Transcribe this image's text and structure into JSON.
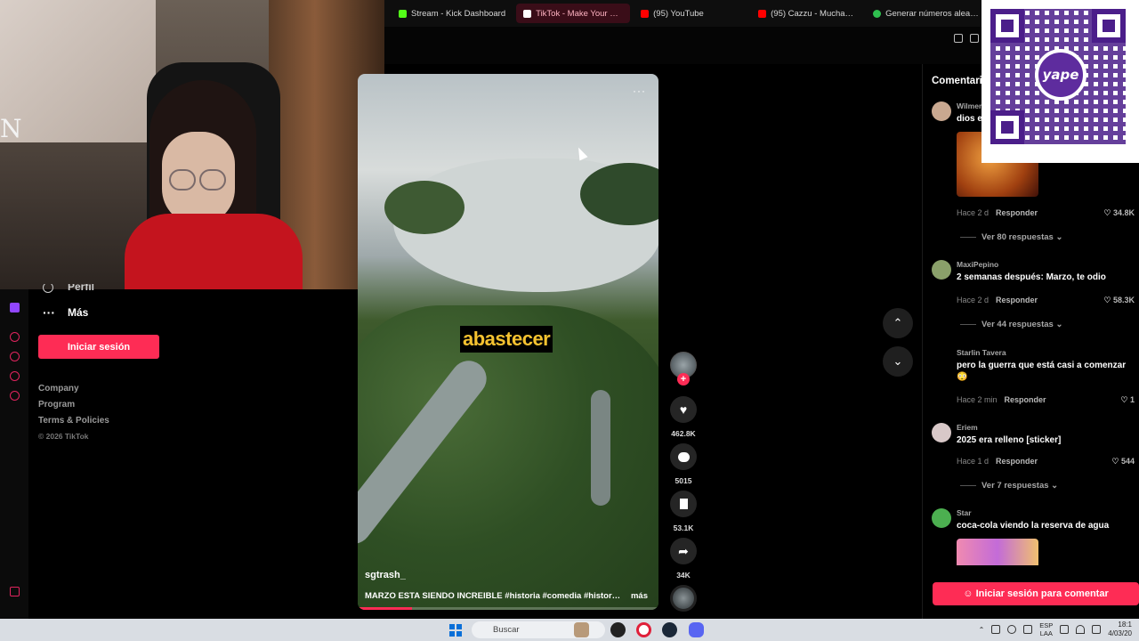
{
  "browser": {
    "tabs": [
      {
        "label": "Stream - Kick Dashboard",
        "icon": "kick-icon",
        "color": "#53fc18"
      },
      {
        "label": "TikTok - Make Your Day",
        "icon": "tiktok-icon",
        "color": "#ffffff"
      },
      {
        "label": "(95) YouTube",
        "icon": "youtube-icon",
        "color": "#ff0000"
      },
      {
        "label": "(95) Cazzu - Mucha Data",
        "icon": "youtube-icon",
        "color": "#ff0000"
      },
      {
        "label": "Generar números aleatorios",
        "icon": "clover-icon",
        "color": "#2fbf4f"
      }
    ],
    "new_tab": "+"
  },
  "webcam": {
    "wall_letter": "N"
  },
  "sidebar": {
    "partial_item": "Perfil",
    "more_label": "Más",
    "login_button": "Iniciar sesión",
    "footer_links": [
      "Company",
      "Program",
      "Terms & Policies"
    ],
    "copyright": "© 2026 TikTok"
  },
  "video": {
    "caption_word": "abastecer",
    "author": "sgtrash_",
    "description": "MARZO ESTA SIENDO INCREIBLE #historia #comedia #historytiktok",
    "more_link": "más",
    "menu_dots": "···",
    "progress": 0.18,
    "actions": {
      "follow": "+",
      "likes": "462.8K",
      "comments": "5015",
      "saves": "53.1K",
      "shares": "34K"
    }
  },
  "comments": {
    "title": "Comentarios",
    "items": [
      {
        "user": "Wilmer",
        "text": "dios es",
        "time": "Hace 2 d",
        "reply": "Responder",
        "likes": "34.8K",
        "replies": "Ver 80 respuestas",
        "avatar_color": "#c9a890"
      },
      {
        "user": "MaxiPepino",
        "text": "2 semanas después: Marzo, te odio",
        "time": "Hace 2 d",
        "reply": "Responder",
        "likes": "58.3K",
        "replies": "Ver 44 respuestas",
        "avatar_color": "#8aa06a"
      },
      {
        "user": "Starlin Tavera",
        "text": "pero la guerra que está casi a comenzar 😳",
        "time": "Hace 2 min",
        "reply": "Responder",
        "likes": "1",
        "replies": "",
        "avatar_color": "#000000"
      },
      {
        "user": "Eriem",
        "text": "2025 era relleno [sticker]",
        "time": "Hace 1 d",
        "reply": "Responder",
        "likes": "544",
        "replies": "Ver 7 respuestas",
        "avatar_color": "#d8c8c8"
      },
      {
        "user": "Star",
        "text": "coca-cola viendo la reserva de agua",
        "time": "",
        "reply": "",
        "likes": "",
        "replies": "",
        "avatar_color": "#4caf50"
      }
    ],
    "login_button": "Iniciar sesión para comentar"
  },
  "qr": {
    "brand": "yape"
  },
  "taskbar": {
    "search_placeholder": "Buscar",
    "lang_line1": "ESP",
    "lang_line2": "LAA",
    "time": "18:1",
    "date": "4/03/20"
  },
  "colors": {
    "accent": "#fe2c55",
    "qr_purple": "#4b1e8a"
  }
}
